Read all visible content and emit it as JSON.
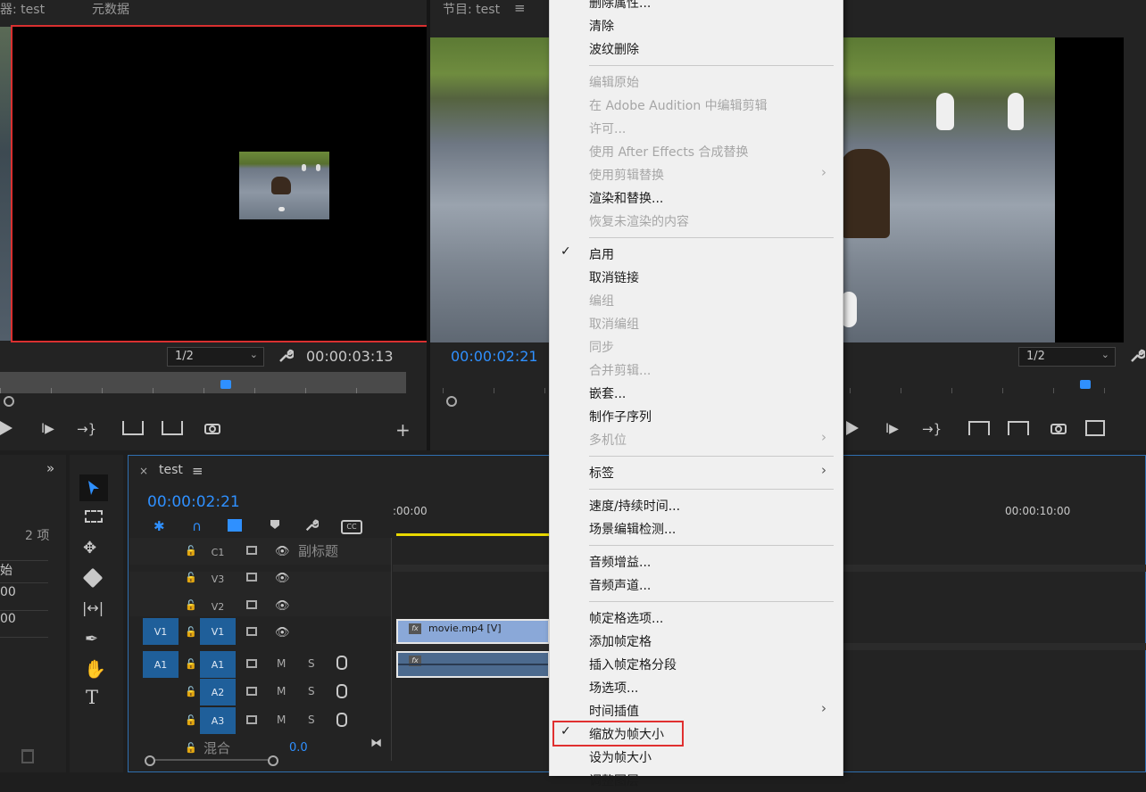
{
  "source_monitor": {
    "tab_title": "器: test",
    "tab_metadata": "元数据",
    "resolution": "1/2",
    "timecode": "00:00:03:13"
  },
  "program_monitor": {
    "tab_title": "节目: test",
    "timecode": "00:00:02:21",
    "resolution": "1/2"
  },
  "project": {
    "item_count": "2 项",
    "list": [
      "始",
      "00",
      "00"
    ]
  },
  "timeline": {
    "sequence_name": "test",
    "timecode": "00:00:02:21",
    "ruler": {
      "start": ":00:00",
      "mark": "00:00:10:00"
    },
    "tracks": [
      {
        "label": "C1",
        "name": "副标题"
      },
      {
        "label": "V3"
      },
      {
        "label": "V2"
      },
      {
        "source": "V1",
        "label": "V1"
      },
      {
        "source": "A1",
        "label": "A1",
        "m": "M",
        "s": "S"
      },
      {
        "label": "A2",
        "m": "M",
        "s": "S"
      },
      {
        "label": "A3",
        "m": "M",
        "s": "S"
      }
    ],
    "mix_label": "混合",
    "mix_value": "0.0",
    "clip_video": "movie.mp4 [V]"
  },
  "context_menu": {
    "items": [
      {
        "label": "删除属性...",
        "disabled": false
      },
      {
        "label": "清除",
        "disabled": false
      },
      {
        "label": "波纹删除",
        "disabled": false
      },
      {
        "sep": true
      },
      {
        "label": "编辑原始",
        "disabled": true
      },
      {
        "label": "在 Adobe Audition 中编辑剪辑",
        "disabled": true
      },
      {
        "label": "许可...",
        "disabled": true
      },
      {
        "label": "使用 After Effects 合成替换",
        "disabled": true
      },
      {
        "label": "使用剪辑替换",
        "disabled": true,
        "submenu": true
      },
      {
        "label": "渲染和替换...",
        "disabled": false
      },
      {
        "label": "恢复未渲染的内容",
        "disabled": true
      },
      {
        "sep": true
      },
      {
        "label": "启用",
        "disabled": false,
        "checked": true
      },
      {
        "label": "取消链接",
        "disabled": false
      },
      {
        "label": "编组",
        "disabled": true
      },
      {
        "label": "取消编组",
        "disabled": true
      },
      {
        "label": "同步",
        "disabled": true
      },
      {
        "label": "合并剪辑...",
        "disabled": true
      },
      {
        "label": "嵌套...",
        "disabled": false
      },
      {
        "label": "制作子序列",
        "disabled": false
      },
      {
        "label": "多机位",
        "disabled": true,
        "submenu": true
      },
      {
        "sep": true
      },
      {
        "label": "标签",
        "disabled": false,
        "submenu": true
      },
      {
        "sep": true
      },
      {
        "label": "速度/持续时间...",
        "disabled": false
      },
      {
        "label": "场景编辑检测...",
        "disabled": false
      },
      {
        "sep": true
      },
      {
        "label": "音频增益...",
        "disabled": false
      },
      {
        "label": "音频声道...",
        "disabled": false
      },
      {
        "sep": true
      },
      {
        "label": "帧定格选项...",
        "disabled": false
      },
      {
        "label": "添加帧定格",
        "disabled": false
      },
      {
        "label": "插入帧定格分段",
        "disabled": false
      },
      {
        "label": "场选项...",
        "disabled": false
      },
      {
        "label": "时间插值",
        "disabled": false,
        "submenu": true
      },
      {
        "label": "缩放为帧大小",
        "disabled": false,
        "checked": true,
        "highlighted": true
      },
      {
        "label": "设为帧大小",
        "disabled": false
      },
      {
        "label": "调整图层",
        "disabled": false
      }
    ]
  },
  "colors": {
    "accent_blue": "#2f90ff",
    "highlight_red": "#e03030",
    "playhead_yellow": "#e8d800"
  }
}
